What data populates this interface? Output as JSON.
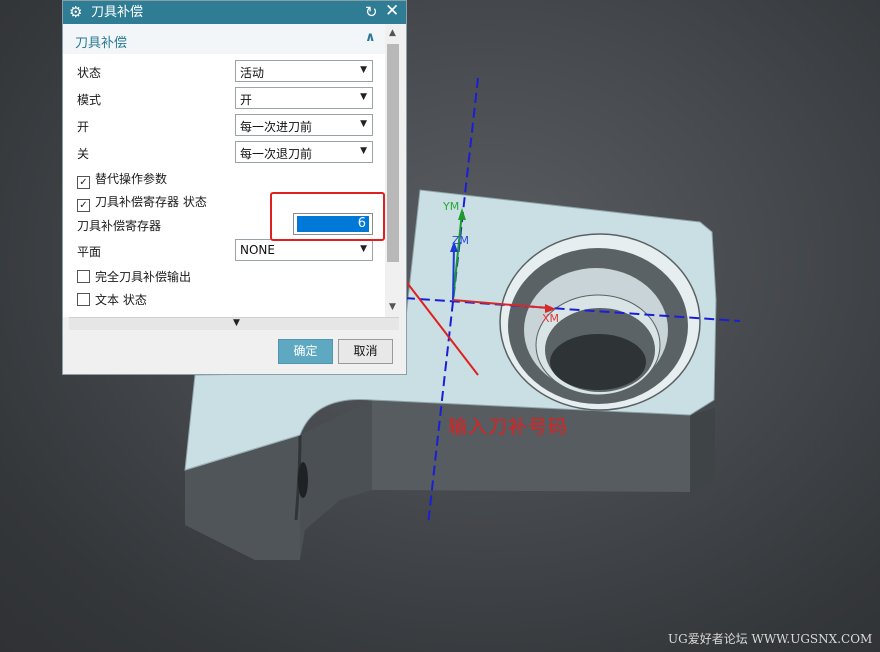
{
  "dialog": {
    "title": "刀具补偿",
    "icons": {
      "settings": "gear-icon",
      "reset": "reset-icon",
      "close": "close-icon"
    },
    "group": {
      "label": "刀具补偿",
      "caret": "∧"
    },
    "fields": {
      "status": {
        "label": "状态",
        "value": "活动"
      },
      "mode": {
        "label": "模式",
        "value": "开"
      },
      "on": {
        "label": "开",
        "value": "每一次进刀前"
      },
      "off": {
        "label": "关",
        "value": "每一次退刀前"
      },
      "override": {
        "label": "替代操作参数",
        "checked": true
      },
      "register_status": {
        "label": "刀具补偿寄存器 状态",
        "checked": true
      },
      "register": {
        "label": "刀具补偿寄存器",
        "value": "6"
      },
      "plane": {
        "label": "平面",
        "value": "NONE"
      },
      "full_output": {
        "label": "完全刀具补偿输出",
        "checked": false
      },
      "text_status": {
        "label": "文本 状态",
        "checked": false
      }
    },
    "buttons": {
      "ok": "确定",
      "cancel": "取消"
    }
  },
  "viewport": {
    "axes": {
      "ym": "YM",
      "zm": "ZM",
      "xm": "XM"
    }
  },
  "annotation": {
    "text": "输入刀补号码",
    "color": "#e02020"
  },
  "watermark": "UG爱好者论坛 WWW.UGSNX.COM",
  "colors": {
    "title_bar": "#2f7d95",
    "accent": "#2a7a95",
    "ok_button": "#5ea8c2",
    "part_top": "#c6dde1",
    "part_side": "#5d6366"
  }
}
